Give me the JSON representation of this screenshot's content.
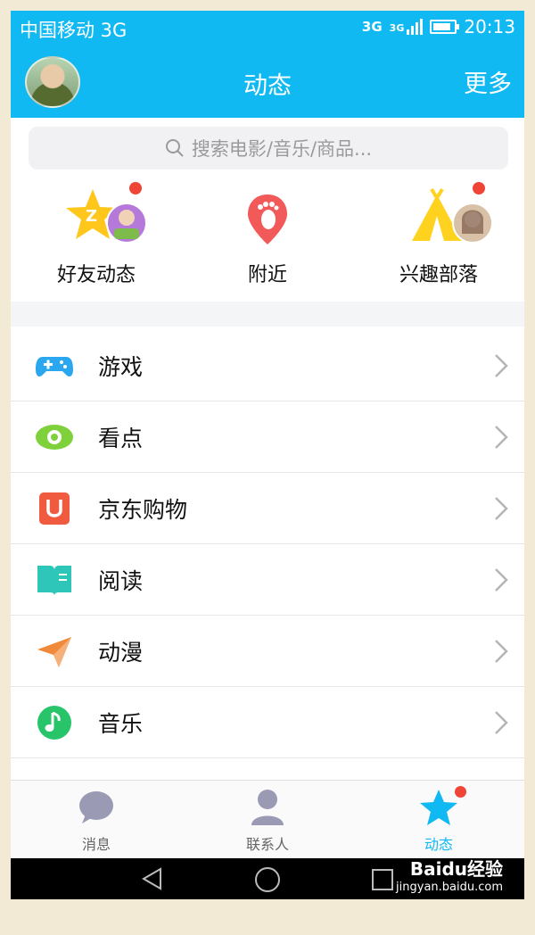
{
  "status_bar": {
    "carrier": "中国移动 3G",
    "net1": "3G",
    "net2": "3G",
    "time": "20:13"
  },
  "header": {
    "title": "动态",
    "more": "更多"
  },
  "search": {
    "placeholder": "搜索电影/音乐/商品..."
  },
  "shortcuts": [
    {
      "label": "好友动态",
      "icon": "qzone-star-icon",
      "has_dot": true
    },
    {
      "label": "附近",
      "icon": "nearby-footprint-icon",
      "has_dot": false
    },
    {
      "label": "兴趣部落",
      "icon": "tribe-tent-icon",
      "has_dot": true
    }
  ],
  "list": [
    {
      "label": "游戏",
      "icon": "gamepad-icon",
      "color": "#2aa7ee"
    },
    {
      "label": "看点",
      "icon": "eye-icon",
      "color": "#7fd13b"
    },
    {
      "label": "京东购物",
      "icon": "jd-shopping-icon",
      "color": "#f05a3e"
    },
    {
      "label": "阅读",
      "icon": "book-icon",
      "color": "#2ec6b8"
    },
    {
      "label": "动漫",
      "icon": "paper-plane-icon",
      "color": "#f08a3a"
    },
    {
      "label": "音乐",
      "icon": "music-note-icon",
      "color": "#27c46a"
    }
  ],
  "tabs": [
    {
      "label": "消息",
      "icon": "message-bubble-icon",
      "active": false
    },
    {
      "label": "联系人",
      "icon": "contact-person-icon",
      "active": false
    },
    {
      "label": "动态",
      "icon": "star-icon",
      "active": true
    }
  ],
  "watermark": {
    "brand": "Baidu经验",
    "url": "jingyan.baidu.com"
  },
  "colors": {
    "accent": "#11b9f2",
    "dot": "#ef4536"
  }
}
